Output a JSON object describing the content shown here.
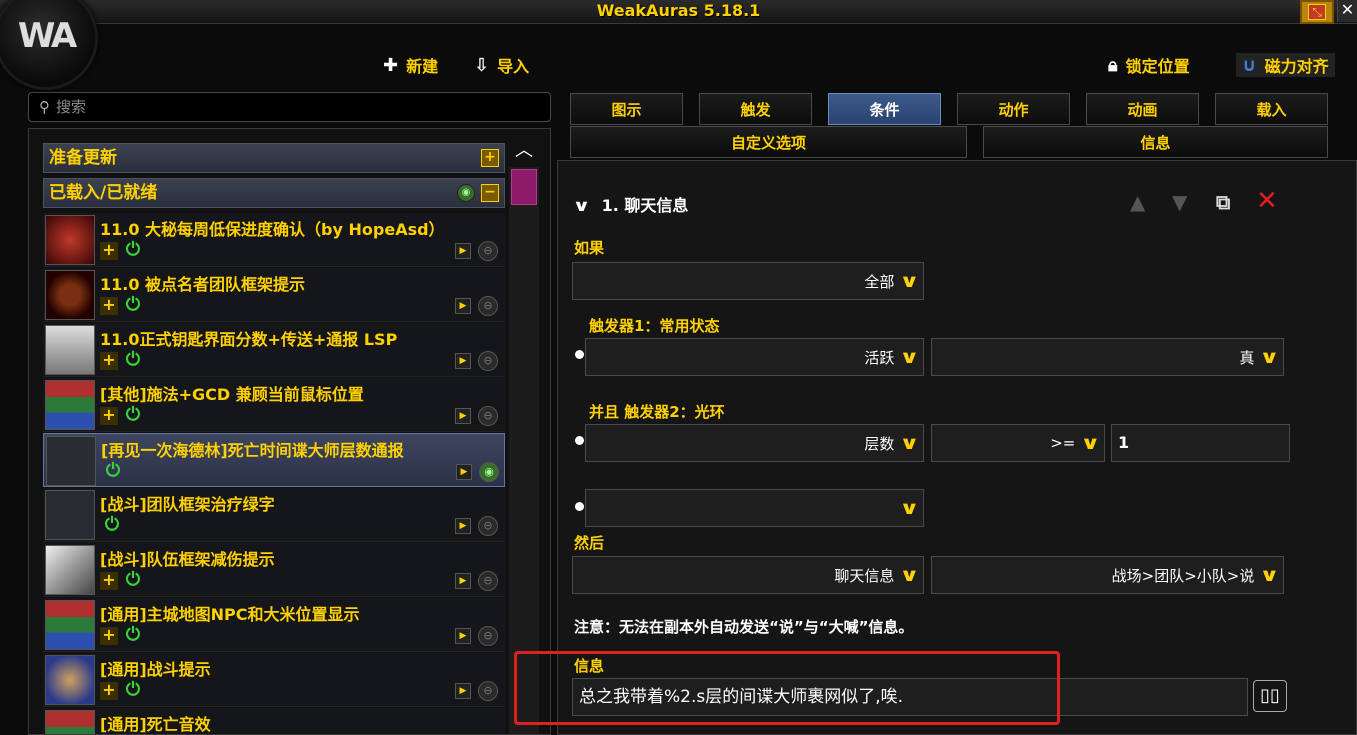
{
  "window": {
    "title": "WeakAuras 5.18.1"
  },
  "toolbar": {
    "new_label": "新建",
    "import_label": "导入",
    "lock_label": "锁定位置",
    "magnet_label": "磁力对齐"
  },
  "search": {
    "placeholder": "搜索"
  },
  "groups": {
    "update": "准备更新",
    "loaded": "已载入/已就绪"
  },
  "auras": [
    {
      "name": "11.0 大秘每周低保进度确认（by HopeAsd）",
      "icon": "fire-spell-icon",
      "loaded": false
    },
    {
      "name": "11.0 被点名者团队框架提示",
      "icon": "target-spell-icon",
      "loaded": false
    },
    {
      "name": "11.0正式钥匙界面分数+传送+通报 LSP",
      "icon": "gauntlet-icon",
      "loaded": false
    },
    {
      "name": "[其他]施法+GCD 兼顾当前鼠标位置",
      "icon": "color-grid-icon",
      "loaded": false
    },
    {
      "name": "[再见一次海德林]死亡时间谍大师层数通报",
      "icon": "empty-icon",
      "loaded": true,
      "selected": true
    },
    {
      "name": "[战斗]团队框架治疗绿字",
      "icon": "empty-icon",
      "loaded": false
    },
    {
      "name": "[战斗]队伍框架减伤提示",
      "icon": "shield-icon",
      "loaded": false
    },
    {
      "name": "[通用]主城地图NPC和大米位置显示",
      "icon": "color-grid-icon",
      "loaded": false
    },
    {
      "name": "[通用]战斗提示",
      "icon": "fist-icon",
      "loaded": false
    },
    {
      "name": "[通用]死亡音效",
      "icon": "color-grid-icon",
      "loaded": false
    }
  ],
  "tabs_row1": [
    "图示",
    "触发",
    "条件",
    "动作",
    "动画",
    "载入"
  ],
  "tabs_row2": [
    "自定义选项",
    "信息"
  ],
  "active_tab": "条件",
  "condition": {
    "header": "1. 聊天信息",
    "if_label": "如果",
    "if_value": "全部",
    "trigger1_label": "触发器1：常用状态",
    "trigger1_left": "活跃",
    "trigger1_right": "真",
    "trigger2_label": "并且 触发器2：光环",
    "trigger2_left": "层数",
    "trigger2_op": ">=",
    "trigger2_value": "1",
    "empty_select": "",
    "then_label": "然后",
    "then_left": "聊天信息",
    "then_right": "战场>团队>小队>说",
    "note": "注意：无法在副本外自动发送“说”与“大喊”信息。",
    "message_label": "信息",
    "message_value": "总之我带着%2.s层的间谍大师裹网似了,唉."
  },
  "colors": {
    "accent_gold": "#ffd100",
    "active_tab": "#2a4370",
    "highlight_red": "#e02020",
    "power_green": "#3ad43a"
  }
}
